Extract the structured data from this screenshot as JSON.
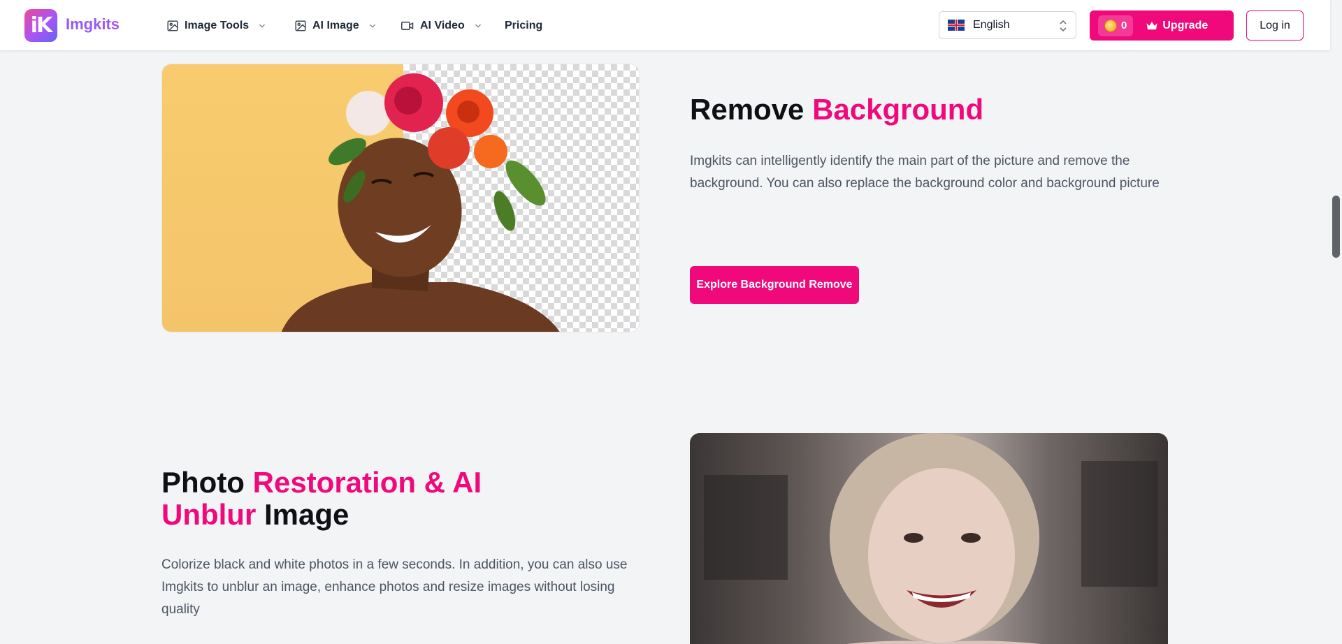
{
  "header": {
    "brand": "Imgkits",
    "logo_letters": "iK",
    "nav": [
      {
        "label": "Image Tools",
        "icon": "image-icon",
        "has_dropdown": true
      },
      {
        "label": "AI Image",
        "icon": "image-icon",
        "has_dropdown": true
      },
      {
        "label": "AI Video",
        "icon": "video-icon",
        "has_dropdown": true
      },
      {
        "label": "Pricing",
        "has_dropdown": false
      }
    ],
    "language": {
      "selected": "English",
      "flag": "uk-flag-icon"
    },
    "credits": "0",
    "upgrade_label": "Upgrade",
    "login_label": "Log in"
  },
  "sections": {
    "remove_bg": {
      "title_plain": "Remove ",
      "title_accent": "Background",
      "description": "Imgkits can intelligently identify the main part of the picture and remove the background. You can also replace the background color and background picture",
      "cta_label": "Explore Background Remove"
    },
    "restoration": {
      "title_plain_1": "Photo ",
      "title_accent_1": "Restoration & AI",
      "title_accent_2": "Unblur",
      "title_plain_2": " Image",
      "description": "Colorize black and white photos in a few seconds. In addition, you can also use Imgkits to unblur an image, enhance photos and resize images without losing quality"
    }
  },
  "colors": {
    "accent": "#f0097a",
    "brand_purple": "#8b5cf6",
    "page_bg": "#f3f4f6"
  }
}
